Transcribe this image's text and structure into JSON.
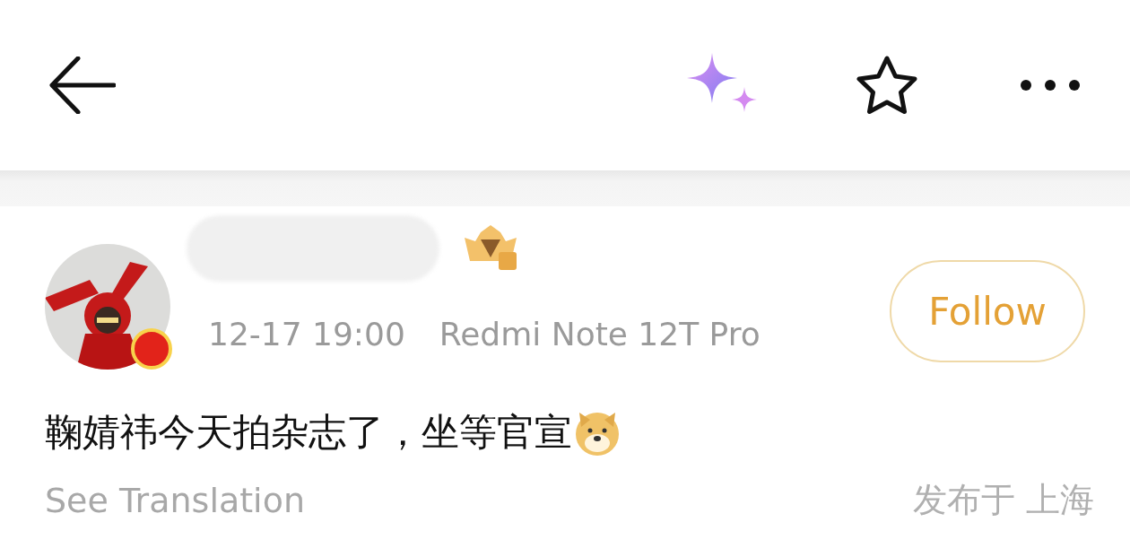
{
  "post": {
    "meta": {
      "time": "12-17 19:00",
      "device": "Redmi Note 12T Pro"
    },
    "follow_button": "Follow",
    "text": "鞠婧祎今天拍杂志了，坐等官宣",
    "translate_link": "See Translation",
    "location": "发布于 上海"
  }
}
